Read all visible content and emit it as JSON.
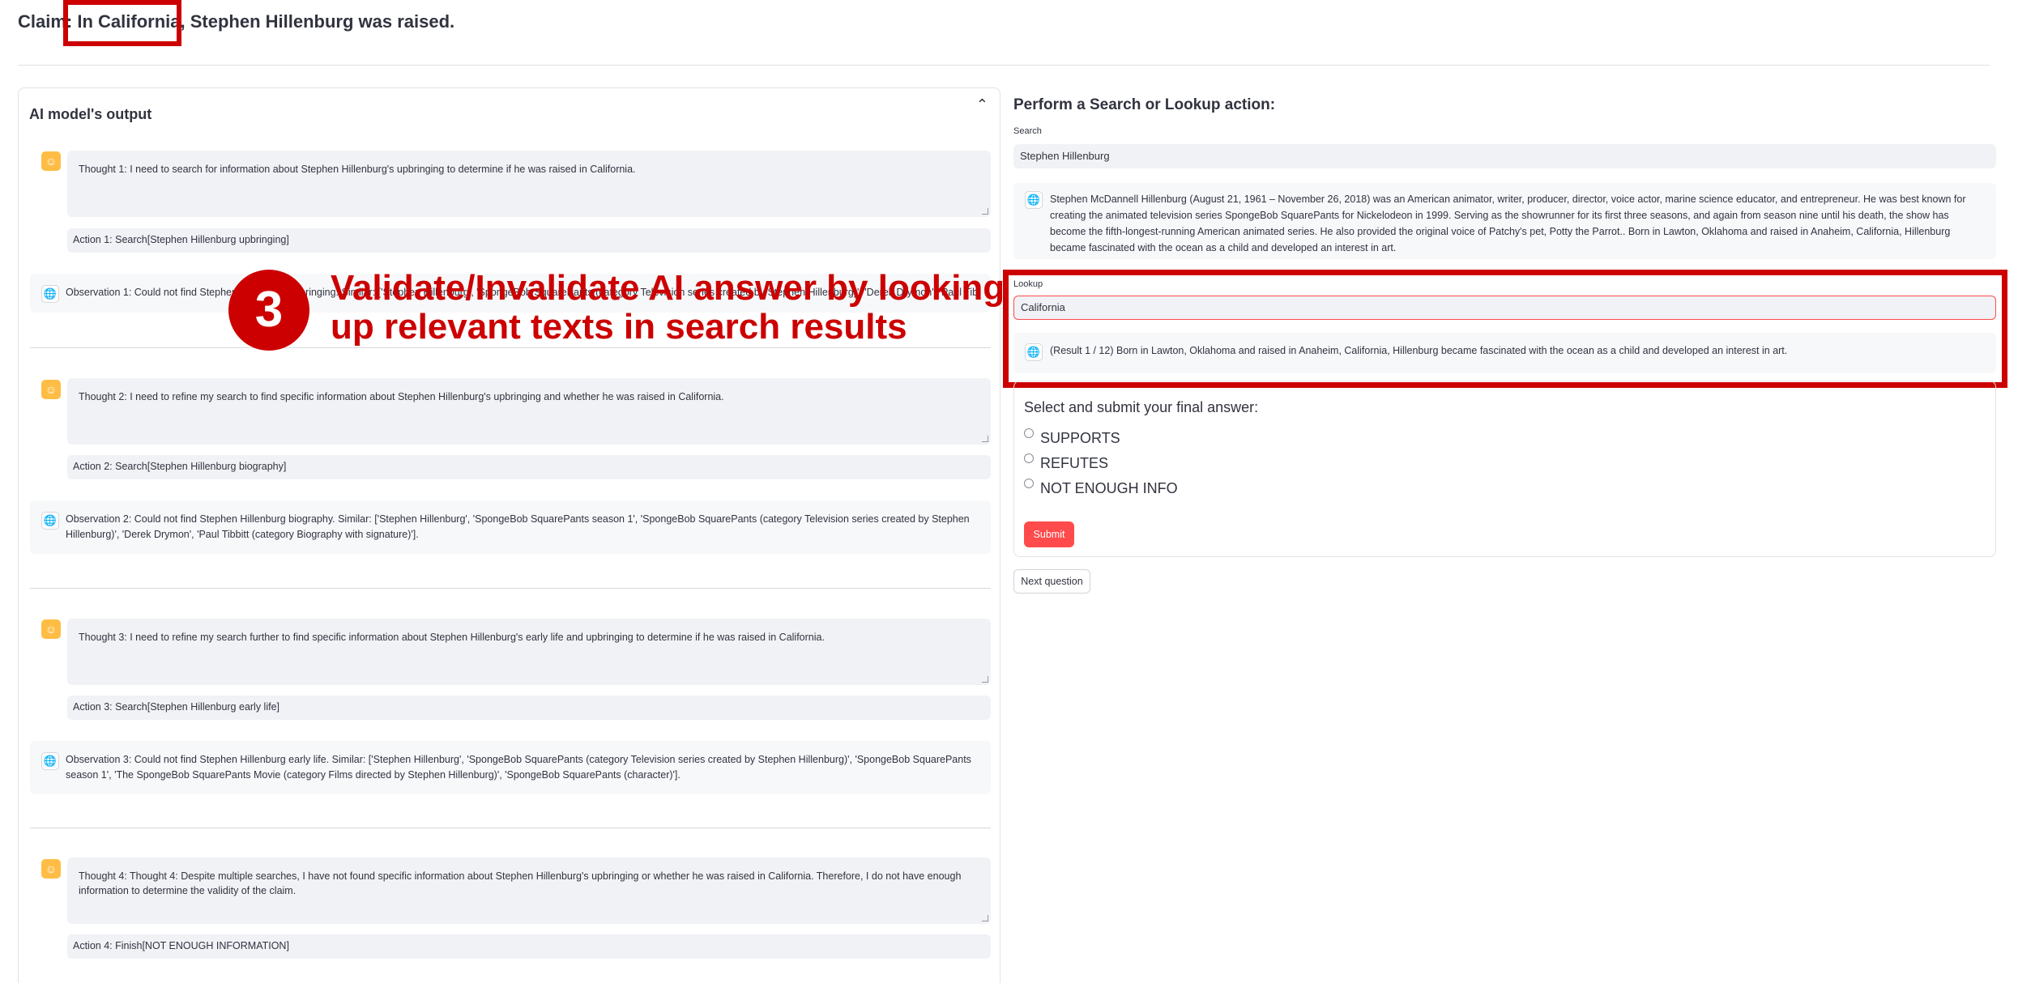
{
  "claim": {
    "label": "Claim:",
    "highlight": "In California,",
    "rest": "Stephen Hillenburg was raised."
  },
  "left_panel": {
    "title": "AI model's output",
    "collapse_icon": "chevron-up-icon",
    "steps": [
      {
        "thought": "Thought 1: I need to search for information about Stephen Hillenburg's upbringing to determine if he was raised in California.",
        "action": "Action 1: Search[Stephen Hillenburg upbringing]",
        "observation": "Observation 1: Could not find Stephen Hillenburg upbringing. Similar: ['Stephen Hillenburg', 'SpongeBob SquarePants (category Television series created by Stephen Hillenburg)', 'Derek Drymon', 'Paul Tibbitt (category Biography with signature)']."
      },
      {
        "thought": "Thought 2: I need to refine my search to find specific information about Stephen Hillenburg's upbringing and whether he was raised in California.",
        "action": "Action 2: Search[Stephen Hillenburg biography]",
        "observation": "Observation 2: Could not find Stephen Hillenburg biography. Similar: ['Stephen Hillenburg', 'SpongeBob SquarePants season 1', 'SpongeBob SquarePants (category Television series created by Stephen Hillenburg)', 'Derek Drymon', 'Paul Tibbitt (category Biography with signature)']."
      },
      {
        "thought": "Thought 3: I need to refine my search further to find specific information about Stephen Hillenburg's early life and upbringing to determine if he was raised in California.",
        "action": "Action 3: Search[Stephen Hillenburg early life]",
        "observation": "Observation 3: Could not find Stephen Hillenburg early life. Similar: ['Stephen Hillenburg', 'SpongeBob SquarePants (category Television series created by Stephen Hillenburg)', 'SpongeBob SquarePants season 1', 'The SpongeBob SquarePants Movie (category Films directed by Stephen Hillenburg)', 'SpongeBob SquarePants (character)']."
      },
      {
        "thought": "Thought 4: Thought 4: Despite multiple searches, I have not found specific information about Stephen Hillenburg's upbringing or whether he was raised in California. Therefore, I do not have enough information to determine the validity of the claim.",
        "action": "Action 4: Finish[NOT ENOUGH INFORMATION]"
      }
    ]
  },
  "right_panel": {
    "title": "Perform a Search or Lookup action:",
    "search_label": "Search",
    "search_value": "Stephen Hillenburg",
    "search_result": "Stephen McDannell Hillenburg (August 21, 1961 – November 26, 2018) was an American animator, writer, producer, director, voice actor, marine science educator, and entrepreneur. He was best known for creating the animated television series SpongeBob SquarePants for Nickelodeon in 1999. Serving as the showrunner for its first three seasons, and again from season nine until his death, the show has become the fifth-longest-running American animated series. He also provided the original voice of Patchy's pet, Potty the Parrot.. Born in Lawton, Oklahoma and raised in Anaheim, California, Hillenburg became fascinated with the ocean as a child and developed an interest in art.",
    "lookup_label": "Lookup",
    "lookup_value": "California",
    "lookup_result": "(Result 1 / 12) Born in Lawton, Oklahoma and raised in Anaheim, California, Hillenburg became fascinated with the ocean as a child and developed an interest in art.",
    "form_title": "Select and submit your final answer:",
    "options": [
      "SUPPORTS",
      "REFUTES",
      "NOT ENOUGH INFO"
    ],
    "submit_label": "Submit",
    "next_label": "Next question"
  },
  "annotation": {
    "number": "3",
    "text": "Validate/Invalidate AI answer by looking up relevant texts in search results",
    "color": "#cc0000"
  },
  "colors": {
    "accent": "#ff4b4b",
    "avatar": "#ffbd45",
    "highlight": "#cc0000"
  }
}
